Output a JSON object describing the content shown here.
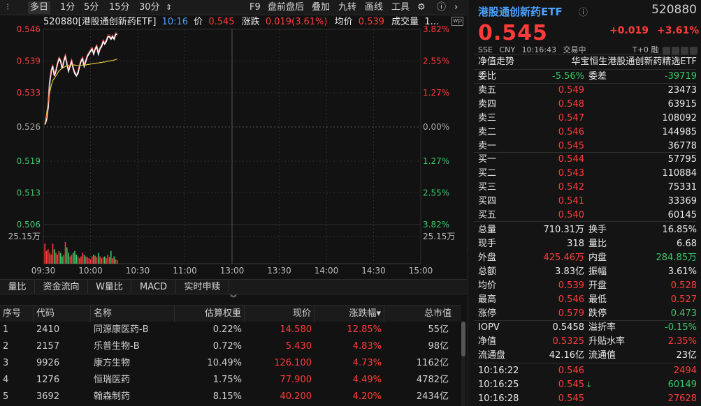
{
  "toolbar": {
    "items": [
      "多日",
      "1分",
      "5分",
      "15分",
      "30分",
      "F9",
      "盘前盘后",
      "叠加",
      "九转",
      "画线",
      "工具"
    ],
    "dropdown_mark": "⇕"
  },
  "chart_header": {
    "code_name": "520880[港股通创新药ETF]",
    "time": "10:16",
    "price_label": "价",
    "price": "0.545",
    "change_label": "涨跌",
    "change": "0.019(3.61%)",
    "avg_label": "均价",
    "avg": "0.539",
    "vol_label": "成交量",
    "vol": "1..."
  },
  "chart_data": {
    "type": "line",
    "title": "",
    "x_ticks": [
      "09:30",
      "10:30",
      "11:00",
      "13:00",
      "13:30",
      "14:00",
      "14:30",
      "15:00"
    ],
    "extra_x_tick": "10:00",
    "y_ticks_left": [
      "0.546",
      "0.539",
      "0.533",
      "0.526",
      "0.519",
      "0.513",
      "0.506"
    ],
    "y_ticks_right": [
      "3.82%",
      "2.55%",
      "1.27%",
      "0.00%",
      "1.27%",
      "2.55%",
      "3.82%"
    ],
    "prev_close": 0.526,
    "ylim": [
      0.506,
      0.546
    ],
    "volume_label": "25.15万",
    "series": [
      {
        "name": "",
        "color": "#ffffff",
        "values": [
          0.5265,
          0.5275,
          0.53,
          0.535,
          0.5375,
          0.5385,
          0.5365,
          0.5375,
          0.539,
          0.54,
          0.5395,
          0.538,
          0.5395,
          0.5405,
          0.539,
          0.5375,
          0.5385,
          0.5395,
          0.538,
          0.537,
          0.5365,
          0.537,
          0.5385,
          0.5395,
          0.54,
          0.5385,
          0.5395,
          0.5405,
          0.541,
          0.5415,
          0.542,
          0.541,
          0.542,
          0.5425,
          0.541,
          0.542,
          0.5425,
          0.5435,
          0.543,
          0.5435,
          0.5445,
          0.5445,
          0.544,
          0.5445,
          0.544,
          0.545,
          0.545
        ]
      },
      {
        "name": "",
        "color": "#e5c33a",
        "values": [
          0.5265,
          0.5285,
          0.531,
          0.533,
          0.5345,
          0.5355,
          0.536,
          0.5365,
          0.537,
          0.5375,
          0.5378,
          0.538,
          0.5382,
          0.5384,
          0.5385,
          0.5386,
          0.5386,
          0.5387,
          0.5387,
          0.5387,
          0.5386,
          0.5386,
          0.5386,
          0.5386,
          0.5387,
          0.5387,
          0.5387,
          0.5388,
          0.5388,
          0.5389,
          0.5389,
          0.539,
          0.539,
          0.5391,
          0.5391,
          0.5392,
          0.5392,
          0.5393,
          0.5393,
          0.5394,
          0.5395,
          0.5395,
          0.5396,
          0.5396,
          0.5397,
          0.5398,
          0.5399
        ]
      }
    ],
    "volumes": [
      0.55,
      0.35,
      0.4,
      0.3,
      0.25,
      0.55,
      0.4,
      0.3,
      0.25,
      0.35,
      0.3,
      0.2,
      0.25,
      0.6,
      0.45,
      0.3,
      0.2,
      0.25,
      0.3,
      0.35,
      0.25,
      0.2,
      0.15,
      0.2,
      0.3,
      0.25,
      0.2,
      0.18,
      0.15,
      0.12,
      0.2,
      0.25,
      0.22,
      0.18,
      0.3,
      0.2,
      0.15,
      0.18,
      0.2,
      0.15,
      0.25,
      0.18,
      0.35,
      0.15,
      0.2,
      0.12,
      0.1
    ]
  },
  "subtabs": [
    "量比",
    "资金流向",
    "W量比",
    "MACD",
    "实时申赎"
  ],
  "table": {
    "headers": [
      "序号",
      "代码",
      "名称",
      "估算权重",
      "现价",
      "涨跌幅",
      "总市值"
    ],
    "sort_mark": "▾",
    "rows": [
      [
        "1",
        "2410",
        "同源康医药-B",
        "0.22%",
        "14.580",
        "12.85%",
        "55亿"
      ],
      [
        "2",
        "2157",
        "乐普生物-B",
        "0.72%",
        "5.430",
        "4.83%",
        "98亿"
      ],
      [
        "3",
        "9926",
        "康方生物",
        "10.49%",
        "126.100",
        "4.73%",
        "1162亿"
      ],
      [
        "4",
        "1276",
        "恒瑞医药",
        "1.75%",
        "77.900",
        "4.49%",
        "4782亿"
      ],
      [
        "5",
        "3692",
        "翰森制药",
        "8.15%",
        "40.200",
        "4.20%",
        "2434亿"
      ]
    ]
  },
  "quote": {
    "name": "港股通创新药ETF",
    "code": "520880",
    "price": "0.545",
    "change": "+0.019",
    "change_pct": "+3.61%",
    "meta": [
      "SSE",
      "CNY",
      "10:16:43",
      "交易中"
    ],
    "t0": "T+0",
    "t0_tag": "融",
    "nav_trend": "净值走势",
    "index_name": "华宝恒生港股通创新药精选ETF",
    "weibi_label": "委比",
    "weibi": "-5.56%",
    "weicha_label": "委差",
    "weicha": "-39719",
    "asks": [
      [
        "卖五",
        "0.549",
        "23473"
      ],
      [
        "卖四",
        "0.548",
        "63915"
      ],
      [
        "卖三",
        "0.547",
        "108092"
      ],
      [
        "卖二",
        "0.546",
        "144985"
      ],
      [
        "卖一",
        "0.545",
        "36778"
      ]
    ],
    "bids": [
      [
        "买一",
        "0.544",
        "57795"
      ],
      [
        "买二",
        "0.543",
        "110884"
      ],
      [
        "买三",
        "0.542",
        "75331"
      ],
      [
        "买四",
        "0.541",
        "33369"
      ],
      [
        "买五",
        "0.540",
        "60145"
      ]
    ],
    "stats": [
      [
        "总量",
        "710.31万",
        "换手",
        "16.85%"
      ],
      [
        "现手",
        "318",
        "量比",
        "6.68"
      ],
      [
        "外盘",
        "425.46万",
        "内盘",
        "284.85万"
      ],
      [
        "总额",
        "3.83亿",
        "振幅",
        "3.61%"
      ],
      [
        "均价",
        "0.539",
        "开盘",
        "0.528"
      ],
      [
        "最高",
        "0.546",
        "最低",
        "0.527"
      ],
      [
        "涨停",
        "0.579",
        "跌停",
        "0.473"
      ]
    ],
    "iopv": [
      [
        "IOPV",
        "0.5458",
        "溢折率",
        "-0.15%"
      ],
      [
        "净值",
        "0.5325",
        "升贴水率",
        "2.35%"
      ],
      [
        "流通盘",
        "42.16亿",
        "流通值",
        "23亿"
      ]
    ],
    "ticks": [
      [
        "10:16:22",
        "0.546",
        "",
        "2494"
      ],
      [
        "10:16:25",
        "0.545",
        "↓",
        "60149"
      ],
      [
        "10:16:28",
        "0.545",
        "",
        "27628"
      ]
    ]
  },
  "colors": {
    "up": "#ff3b3b",
    "down": "#39c86a",
    "accent": "#4ba3ff",
    "price_line": "#ffffff",
    "avg_line": "#e5c33a"
  }
}
